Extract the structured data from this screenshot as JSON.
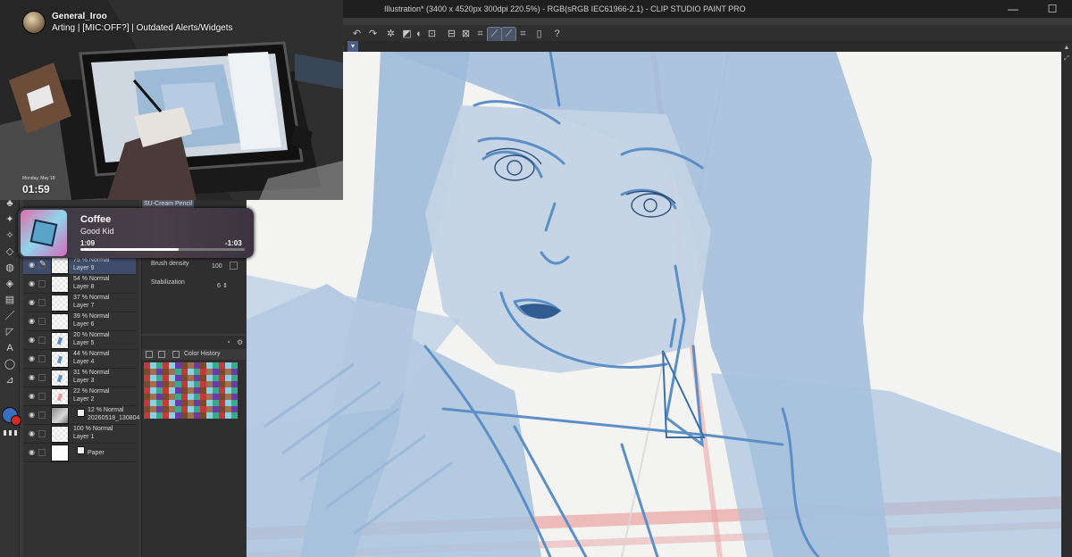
{
  "window": {
    "title": "Illustration* (3400 x 4520px 300dpi 220.5%) - RGB(sRGB IEC61966-2.1) - CLIP STUDIO PAINT PRO",
    "menu_first": "F",
    "minimize": "—",
    "maximize": "☐"
  },
  "tool_property": {
    "tab": "SU-Cream Pencil",
    "brush_density_label": "Brush density",
    "brush_density_value": "100",
    "stabilization_label": "Stabilization",
    "stabilization_value": "6"
  },
  "color_history": {
    "label": "Color History"
  },
  "layers": [
    {
      "mode": "75 % Normal",
      "name": "Layer 9",
      "selected": true,
      "thumb": "checker"
    },
    {
      "mode": "54 % Normal",
      "name": "Layer 8",
      "selected": false,
      "thumb": "checker"
    },
    {
      "mode": "37 % Normal",
      "name": "Layer 7",
      "selected": false,
      "thumb": "checker"
    },
    {
      "mode": "39 % Normal",
      "name": "Layer 6",
      "selected": false,
      "thumb": "checker"
    },
    {
      "mode": "20 % Normal",
      "name": "Layer 5",
      "selected": false,
      "thumb": "checker-mark"
    },
    {
      "mode": "44 % Normal",
      "name": "Layer 4",
      "selected": false,
      "thumb": "checker-mark"
    },
    {
      "mode": "31 % Normal",
      "name": "Layer 3",
      "selected": false,
      "thumb": "checker-mark"
    },
    {
      "mode": "22 % Normal",
      "name": "Layer 2",
      "selected": false,
      "thumb": "checker-red"
    },
    {
      "mode": "12 % Normal",
      "name": "20260518_130804",
      "selected": false,
      "thumb": "photo"
    },
    {
      "mode": "100 % Normal",
      "name": "Layer 1",
      "selected": false,
      "thumb": "checker"
    },
    {
      "mode": "",
      "name": "Paper",
      "selected": false,
      "thumb": "plain"
    }
  ],
  "stream": {
    "username": "General_Iroo",
    "status": "Arting | [MIC:OFF?] | Outdated Alerts/Widgets",
    "date": "Monday, May 18",
    "clock": "01:59"
  },
  "now_playing": {
    "song": "Coffee",
    "artist": "Good Kid",
    "elapsed": "1:09",
    "remaining": "-1:03",
    "progress": 0.6
  },
  "colors": {
    "main_color": "#3a6fbf",
    "sub_color": "#d42a2a",
    "sketch_blue": "#6f9fd0",
    "guide_red": "#e9a3a3"
  },
  "icons": {
    "tools": [
      "zoom-icon",
      "hand-icon",
      "rotate-icon",
      "select-icon",
      "lasso-icon",
      "wand-icon",
      "eyedropper-icon",
      "pen-icon",
      "pencil-icon",
      "brush-icon",
      "airbrush-icon",
      "decoration-icon",
      "eraser-icon",
      "blend-icon",
      "fill-icon",
      "gradient-icon",
      "figure-icon",
      "frame-icon",
      "text-icon",
      "balloon-icon",
      "ruler-icon"
    ]
  }
}
